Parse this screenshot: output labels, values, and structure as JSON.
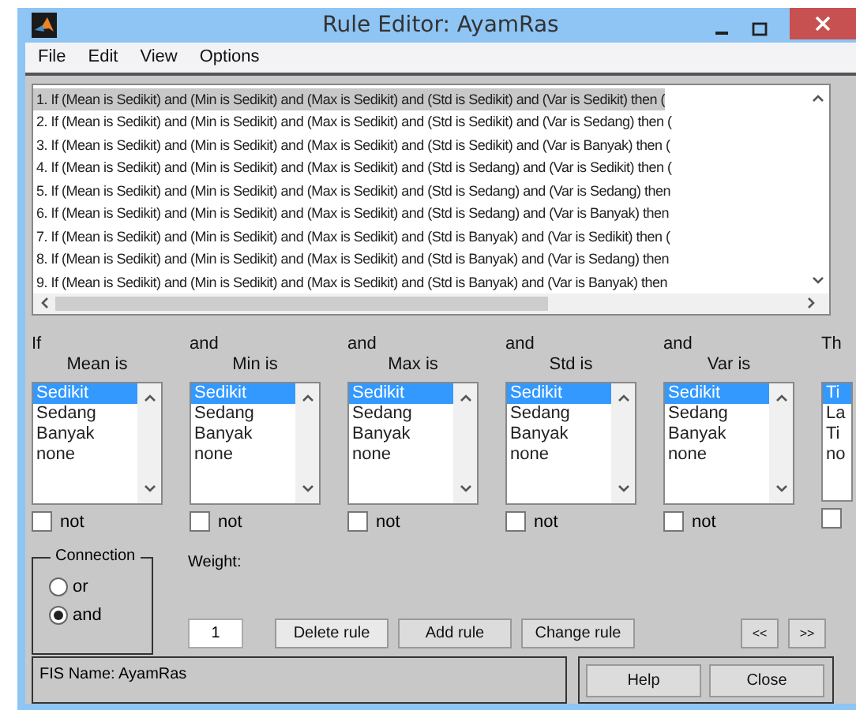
{
  "window": {
    "title": "Rule Editor: AyamRas"
  },
  "menu": [
    "File",
    "Edit",
    "View",
    "Options"
  ],
  "rules": [
    {
      "text": "1. If (Mean is Sedikit) and (Min is Sedikit) and (Max is Sedikit) and (Std is Sedikit) and (Var is Sedikit) then (",
      "selected": true
    },
    {
      "text": "2. If (Mean is Sedikit) and (Min is Sedikit) and (Max is Sedikit) and (Std is Sedikit) and (Var is Sedang) then (",
      "selected": false
    },
    {
      "text": "3. If (Mean is Sedikit) and (Min is Sedikit) and (Max is Sedikit) and (Std is Sedikit) and (Var is Banyak) then (",
      "selected": false
    },
    {
      "text": "4. If (Mean is Sedikit) and (Min is Sedikit) and (Max is Sedikit) and (Std is Sedang) and (Var is Sedikit) then (",
      "selected": false
    },
    {
      "text": "5. If (Mean is Sedikit) and (Min is Sedikit) and (Max is Sedikit) and (Std is Sedang) and (Var is Sedang) then",
      "selected": false
    },
    {
      "text": "6. If (Mean is Sedikit) and (Min is Sedikit) and (Max is Sedikit) and (Std is Sedang) and (Var is Banyak) then",
      "selected": false
    },
    {
      "text": "7. If (Mean is Sedikit) and (Min is Sedikit) and (Max is Sedikit) and (Std is Banyak) and (Var is Sedikit) then (",
      "selected": false
    },
    {
      "text": "8. If (Mean is Sedikit) and (Min is Sedikit) and (Max is Sedikit) and (Std is Banyak) and (Var is Sedang) then",
      "selected": false
    },
    {
      "text": "9. If (Mean is Sedikit) and (Min is Sedikit) and (Max is Sedikit) and (Std is Banyak) and (Var is Banyak) then",
      "selected": false
    }
  ],
  "conditions": [
    {
      "connector": "If",
      "label": "Mean is",
      "options": [
        {
          "text": "Sedikit",
          "selected": true
        },
        {
          "text": "Sedang",
          "selected": false
        },
        {
          "text": "Banyak",
          "selected": false
        },
        {
          "text": "none",
          "selected": false
        }
      ],
      "not": {
        "label": "not",
        "checked": false
      }
    },
    {
      "connector": "and",
      "label": "Min is",
      "options": [
        {
          "text": "Sedikit",
          "selected": true
        },
        {
          "text": "Sedang",
          "selected": false
        },
        {
          "text": "Banyak",
          "selected": false
        },
        {
          "text": "none",
          "selected": false
        }
      ],
      "not": {
        "label": "not",
        "checked": false
      }
    },
    {
      "connector": "and",
      "label": "Max is",
      "options": [
        {
          "text": "Sedikit",
          "selected": true
        },
        {
          "text": "Sedang",
          "selected": false
        },
        {
          "text": "Banyak",
          "selected": false
        },
        {
          "text": "none",
          "selected": false
        }
      ],
      "not": {
        "label": "not",
        "checked": false
      }
    },
    {
      "connector": "and",
      "label": "Std is",
      "options": [
        {
          "text": "Sedikit",
          "selected": true
        },
        {
          "text": "Sedang",
          "selected": false
        },
        {
          "text": "Banyak",
          "selected": false
        },
        {
          "text": "none",
          "selected": false
        }
      ],
      "not": {
        "label": "not",
        "checked": false
      }
    },
    {
      "connector": "and",
      "label": "Var is",
      "options": [
        {
          "text": "Sedikit",
          "selected": true
        },
        {
          "text": "Sedang",
          "selected": false
        },
        {
          "text": "Banyak",
          "selected": false
        },
        {
          "text": "none",
          "selected": false
        }
      ],
      "not": {
        "label": "not",
        "checked": false
      }
    },
    {
      "connector": "Th",
      "options": [
        {
          "text": "Ti",
          "selected": true
        },
        {
          "text": "La",
          "selected": false
        },
        {
          "text": "Ti",
          "selected": false
        },
        {
          "text": "no",
          "selected": false
        }
      ],
      "not": {
        "checked": false
      }
    }
  ],
  "connection": {
    "label": "Connection",
    "options": [
      {
        "label": "or",
        "selected": false
      },
      {
        "label": "and",
        "selected": true
      }
    ]
  },
  "weight": {
    "label": "Weight:",
    "value": "1"
  },
  "rule_buttons": [
    "Delete rule",
    "Add rule",
    "Change rule"
  ],
  "nav_buttons": [
    "<<",
    ">>"
  ],
  "fis_name": "FIS Name: AyamRas",
  "footer_buttons": [
    "Help",
    "Close"
  ]
}
